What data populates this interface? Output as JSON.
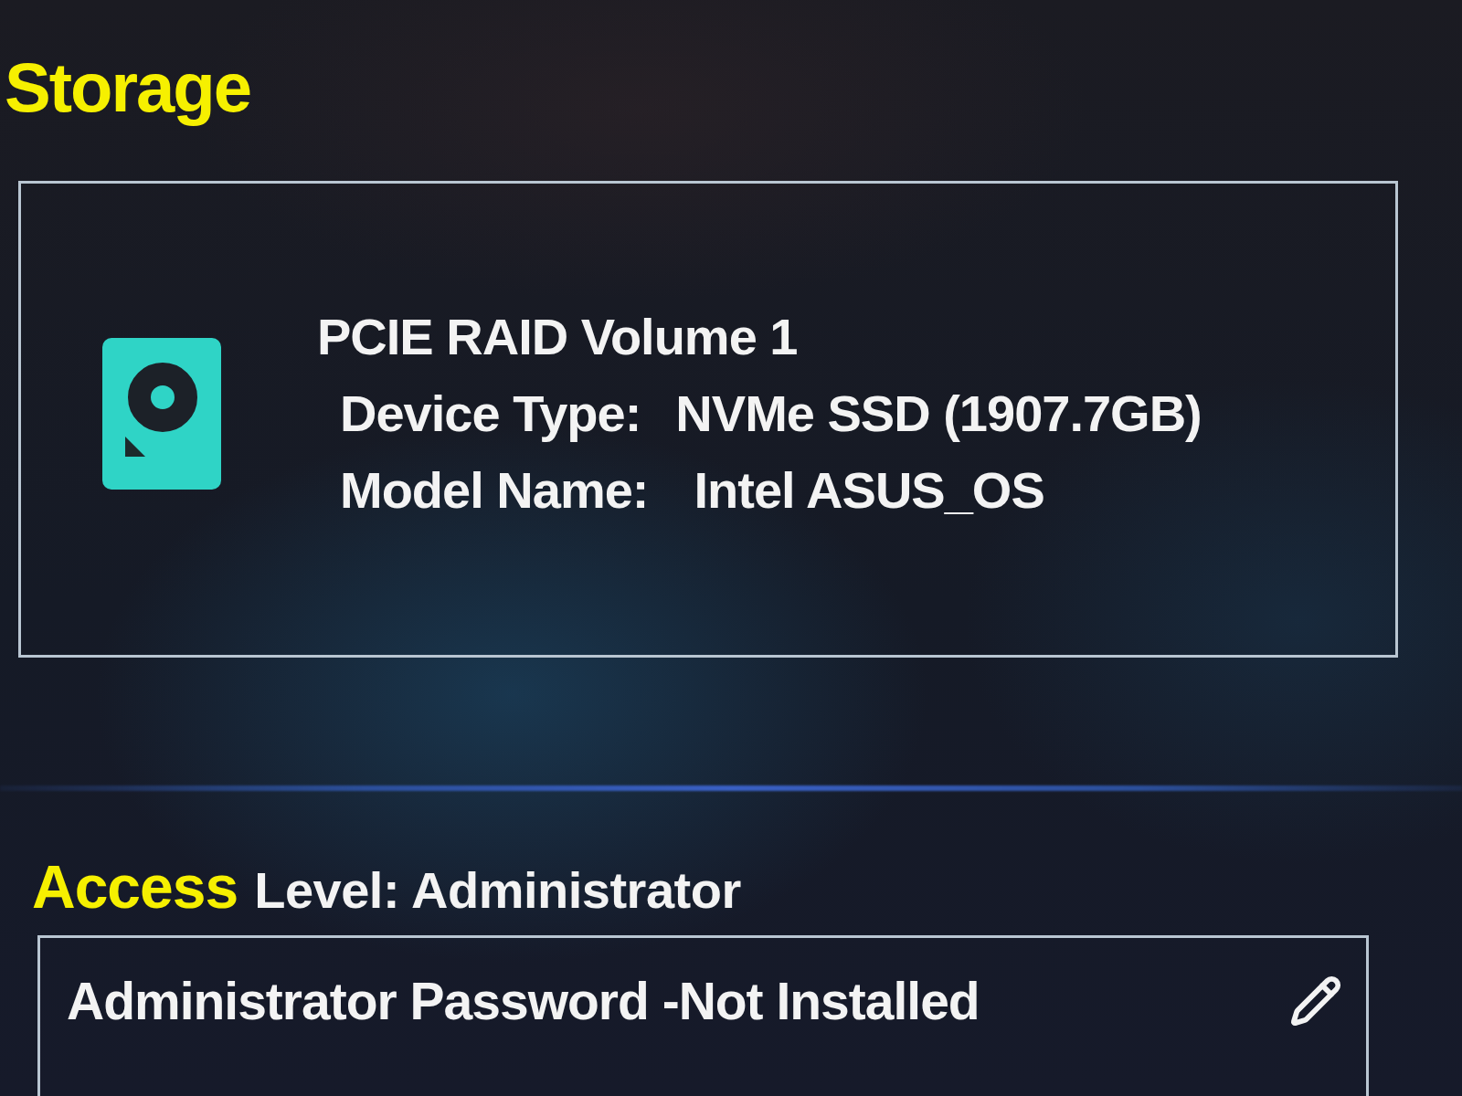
{
  "page_title": "Storage",
  "storage_devices": [
    {
      "name": "PCIE RAID Volume 1",
      "fields": [
        {
          "label": "Device Type:",
          "value": "NVMe SSD (1907.7GB)"
        },
        {
          "label": "Model Name:",
          "value": "Intel ASUS_OS"
        }
      ]
    }
  ],
  "access": {
    "title": "Access",
    "level": "Level: Administrator",
    "items": [
      {
        "label": "Administrator Password -Not Installed"
      }
    ]
  }
}
